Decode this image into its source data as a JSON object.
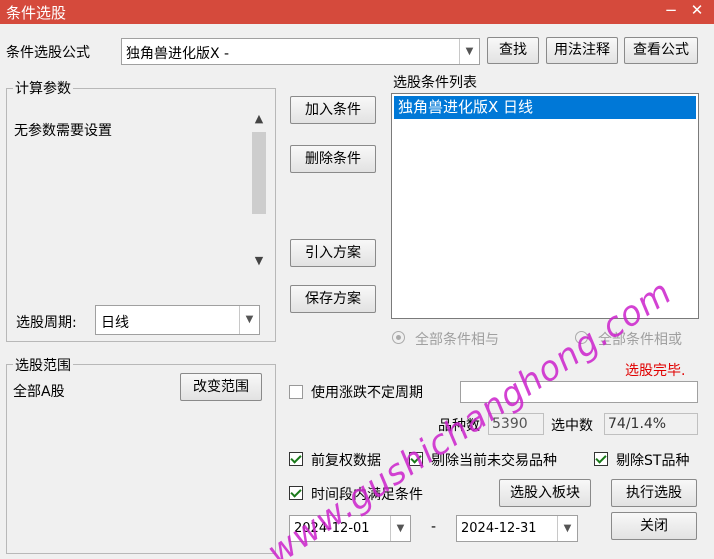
{
  "window": {
    "title": "条件选股",
    "controls": [
      "−",
      "✕"
    ]
  },
  "formula": {
    "label": "条件选股公式",
    "value": "独角兽进化版X  -",
    "find_btn": "查找",
    "usage_btn": "用法注释",
    "view_btn": "查看公式"
  },
  "params": {
    "group_title": "计算参数",
    "text": "无参数需要设置",
    "period_label": "选股周期:",
    "period_value": "日线"
  },
  "actions": {
    "add": "加入条件",
    "delete": "删除条件",
    "import": "引入方案",
    "save": "保存方案"
  },
  "conditions": {
    "label": "选股条件列表",
    "items": [
      "独角兽进化版X  日线"
    ],
    "radio_and": "全部条件相与",
    "radio_or": "全部条件相或",
    "status": "选股完毕."
  },
  "range": {
    "group_title": "选股范围",
    "value": "全部A股",
    "change_btn": "改变范围"
  },
  "variable_period": {
    "label": "使用涨跌不定周期",
    "checked": false
  },
  "stats": {
    "count_label": "品种数",
    "count_value": "5390",
    "selected_label": "选中数",
    "selected_value": "74/1.4%"
  },
  "options": {
    "adjusted": {
      "label": "前复权数据",
      "checked": true
    },
    "exclude_untraded": {
      "label": "剔除当前未交易品种",
      "checked": true
    },
    "exclude_st": {
      "label": "剔除ST品种",
      "checked": true
    },
    "time_range": {
      "label": "时间段内满足条件",
      "checked": true
    }
  },
  "buttons": {
    "to_block": "选股入板块",
    "execute": "执行选股",
    "close": "关闭"
  },
  "dates": {
    "start": "2024-12-01",
    "separator": "-",
    "end": "2024-12-31"
  },
  "watermark": "www.gushichanghong.com",
  "colors": {
    "titlebar": "#d54a3c",
    "selection": "#0078d7",
    "status": "#e00000",
    "watermark": "#cc22cc"
  }
}
